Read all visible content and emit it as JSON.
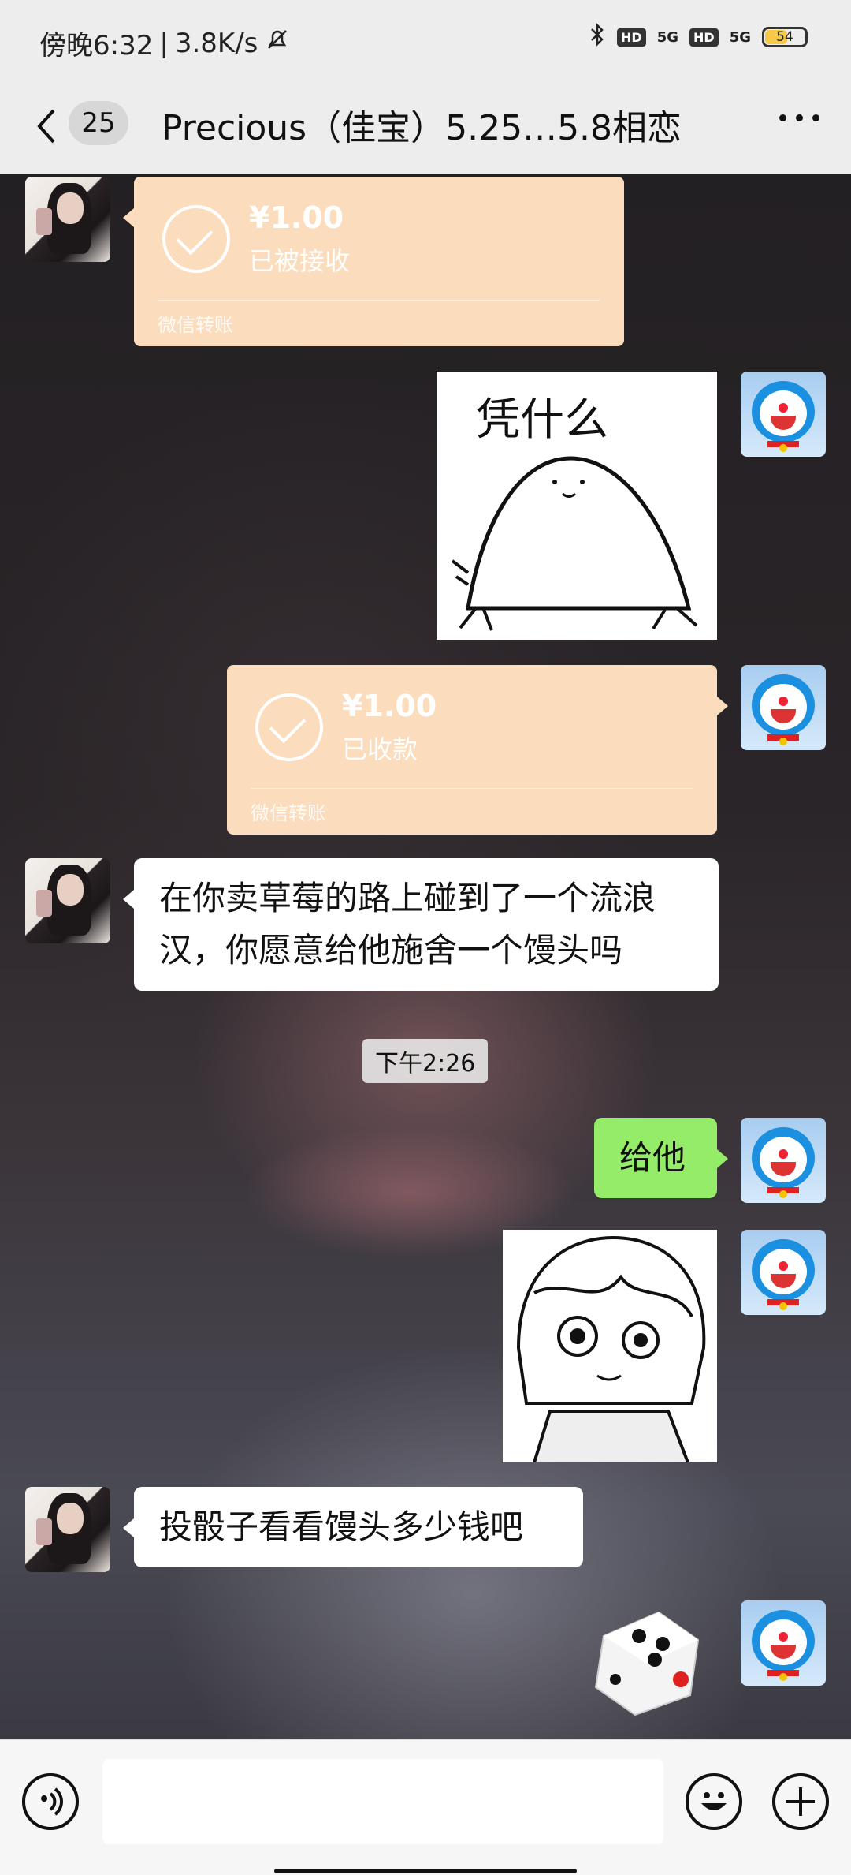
{
  "status_bar": {
    "time": "傍晚6:32",
    "speed": "3.8K/s",
    "network1": "5G",
    "network2": "5G",
    "hd_label": "HD",
    "battery": "54"
  },
  "header": {
    "unread_count": "25",
    "title": "Precious（佳宝）5.25…5.8相恋"
  },
  "messages": {
    "transfer_received": {
      "amount": "¥1.00",
      "status": "已被接收",
      "footer": "微信转账"
    },
    "transfer_collected": {
      "amount": "¥1.00",
      "status": "已收款",
      "footer": "微信转账"
    },
    "question": "在你卖草莓的路上碰到了一个流浪汉，你愿意给他施舍一个馒头吗",
    "timestamp": "下午2:26",
    "reply": "给他",
    "dice_request": "投骰子看看馒头多少钱吧"
  },
  "stickers": {
    "sticker1_text": "凭什么"
  },
  "colors": {
    "transfer_bg": "#fbdcbc",
    "my_bubble": "#95ec69",
    "header_bg": "#ededed"
  },
  "icons": [
    "back-arrow-icon",
    "more-dots-icon",
    "voice-icon",
    "emoji-icon",
    "add-icon",
    "check-icon",
    "bell-mute-icon",
    "bluetooth-icon"
  ]
}
